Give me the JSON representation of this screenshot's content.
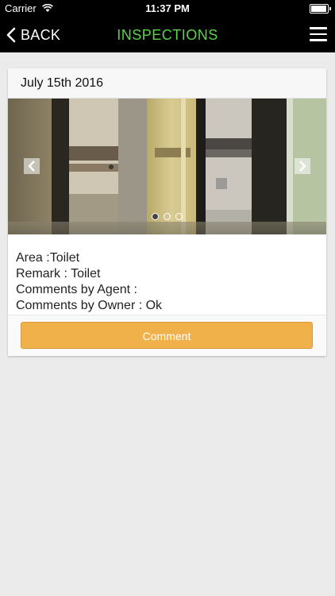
{
  "status_bar": {
    "carrier": "Carrier",
    "time": "11:37 PM",
    "wifi_icon": "wifi-icon",
    "battery_icon": "battery-icon"
  },
  "nav": {
    "back_label": "BACK",
    "title": "INSPECTIONS",
    "title_color": "#5bd34a",
    "menu_icon": "hamburger-menu-icon"
  },
  "inspection": {
    "date": "July 15th 2016",
    "carousel": {
      "image": "bathroom-photo",
      "slide_count": 3,
      "active_slide": 1
    },
    "area_label": "Area :",
    "area_value": "Toilet",
    "remark_label": "Remark : ",
    "remark_value": "Toilet",
    "agent_comments_label": "Comments by Agent : ",
    "agent_comments_value": "",
    "owner_comments_label": "Comments by Owner : ",
    "owner_comments_value": "Ok",
    "comment_button_label": "Comment",
    "comment_button_color": "#f0b04a"
  }
}
